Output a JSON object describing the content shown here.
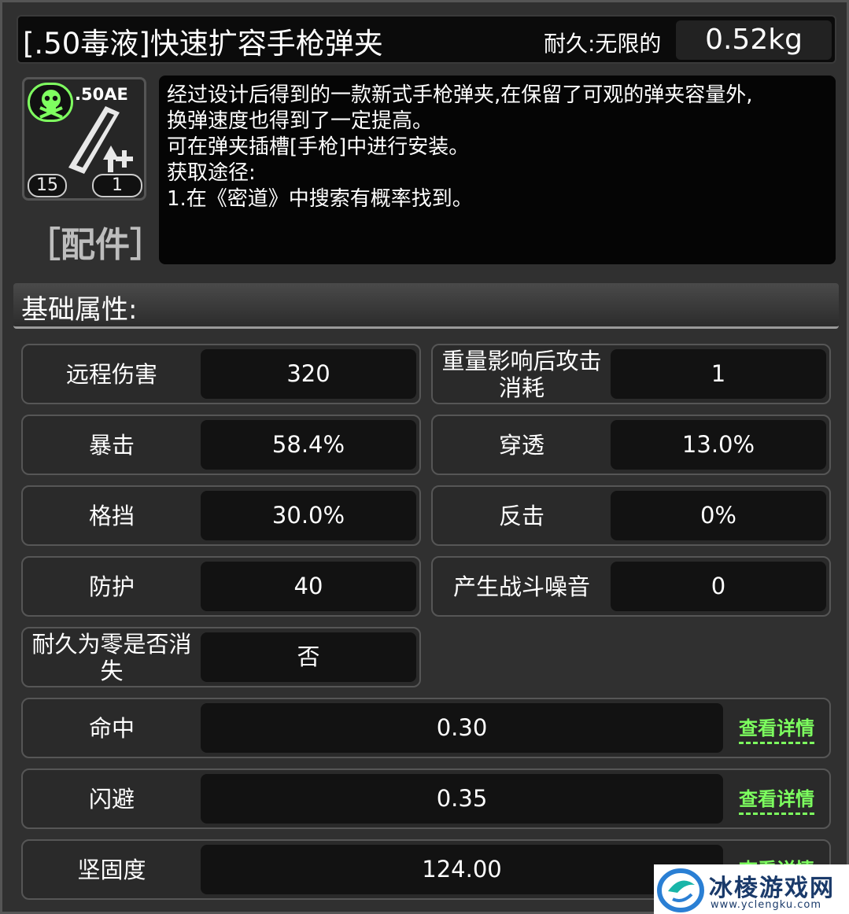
{
  "item": {
    "title": "[.50毒液]快速扩容手枪弹夹",
    "durability_label": "耐久:无限的",
    "weight": "0.52kg",
    "ammo_type": ".50AE",
    "count_left": "15",
    "count_right": "1",
    "category": "［配件］"
  },
  "description": {
    "lines": [
      "经过设计后得到的一款新式手枪弹夹,在保留了可观的弹夹容量外,",
      "换弹速度也得到了一定提高。",
      "可在弹夹插槽[手枪]中进行安装。",
      "获取途径:",
      "1.在《密道》中搜索有概率找到。"
    ]
  },
  "section": {
    "title": "基础属性:"
  },
  "stats": {
    "ranged_damage": {
      "label": "远程伤害",
      "value": "320"
    },
    "weight_attack_cost": {
      "label": "重量影响后攻击消耗",
      "value": "1"
    },
    "crit": {
      "label": "暴击",
      "value": "58.4%"
    },
    "penetration": {
      "label": "穿透",
      "value": "13.0%"
    },
    "block": {
      "label": "格挡",
      "value": "30.0%"
    },
    "counter": {
      "label": "反击",
      "value": "0%"
    },
    "defense": {
      "label": "防护",
      "value": "40"
    },
    "noise": {
      "label": "产生战斗噪音",
      "value": "0"
    },
    "vanish": {
      "label": "耐久为零是否消失",
      "value": "否"
    },
    "hit": {
      "label": "命中",
      "value": "0.30"
    },
    "dodge": {
      "label": "闪避",
      "value": "0.35"
    },
    "toughness": {
      "label": "坚固度",
      "value": "124.00"
    }
  },
  "detail_link": "查看详情",
  "watermark": {
    "name": "冰棱游戏网",
    "url": "www.yclengku.com"
  },
  "colors": {
    "accent_green": "#7dff5f",
    "panel": "#121212"
  }
}
